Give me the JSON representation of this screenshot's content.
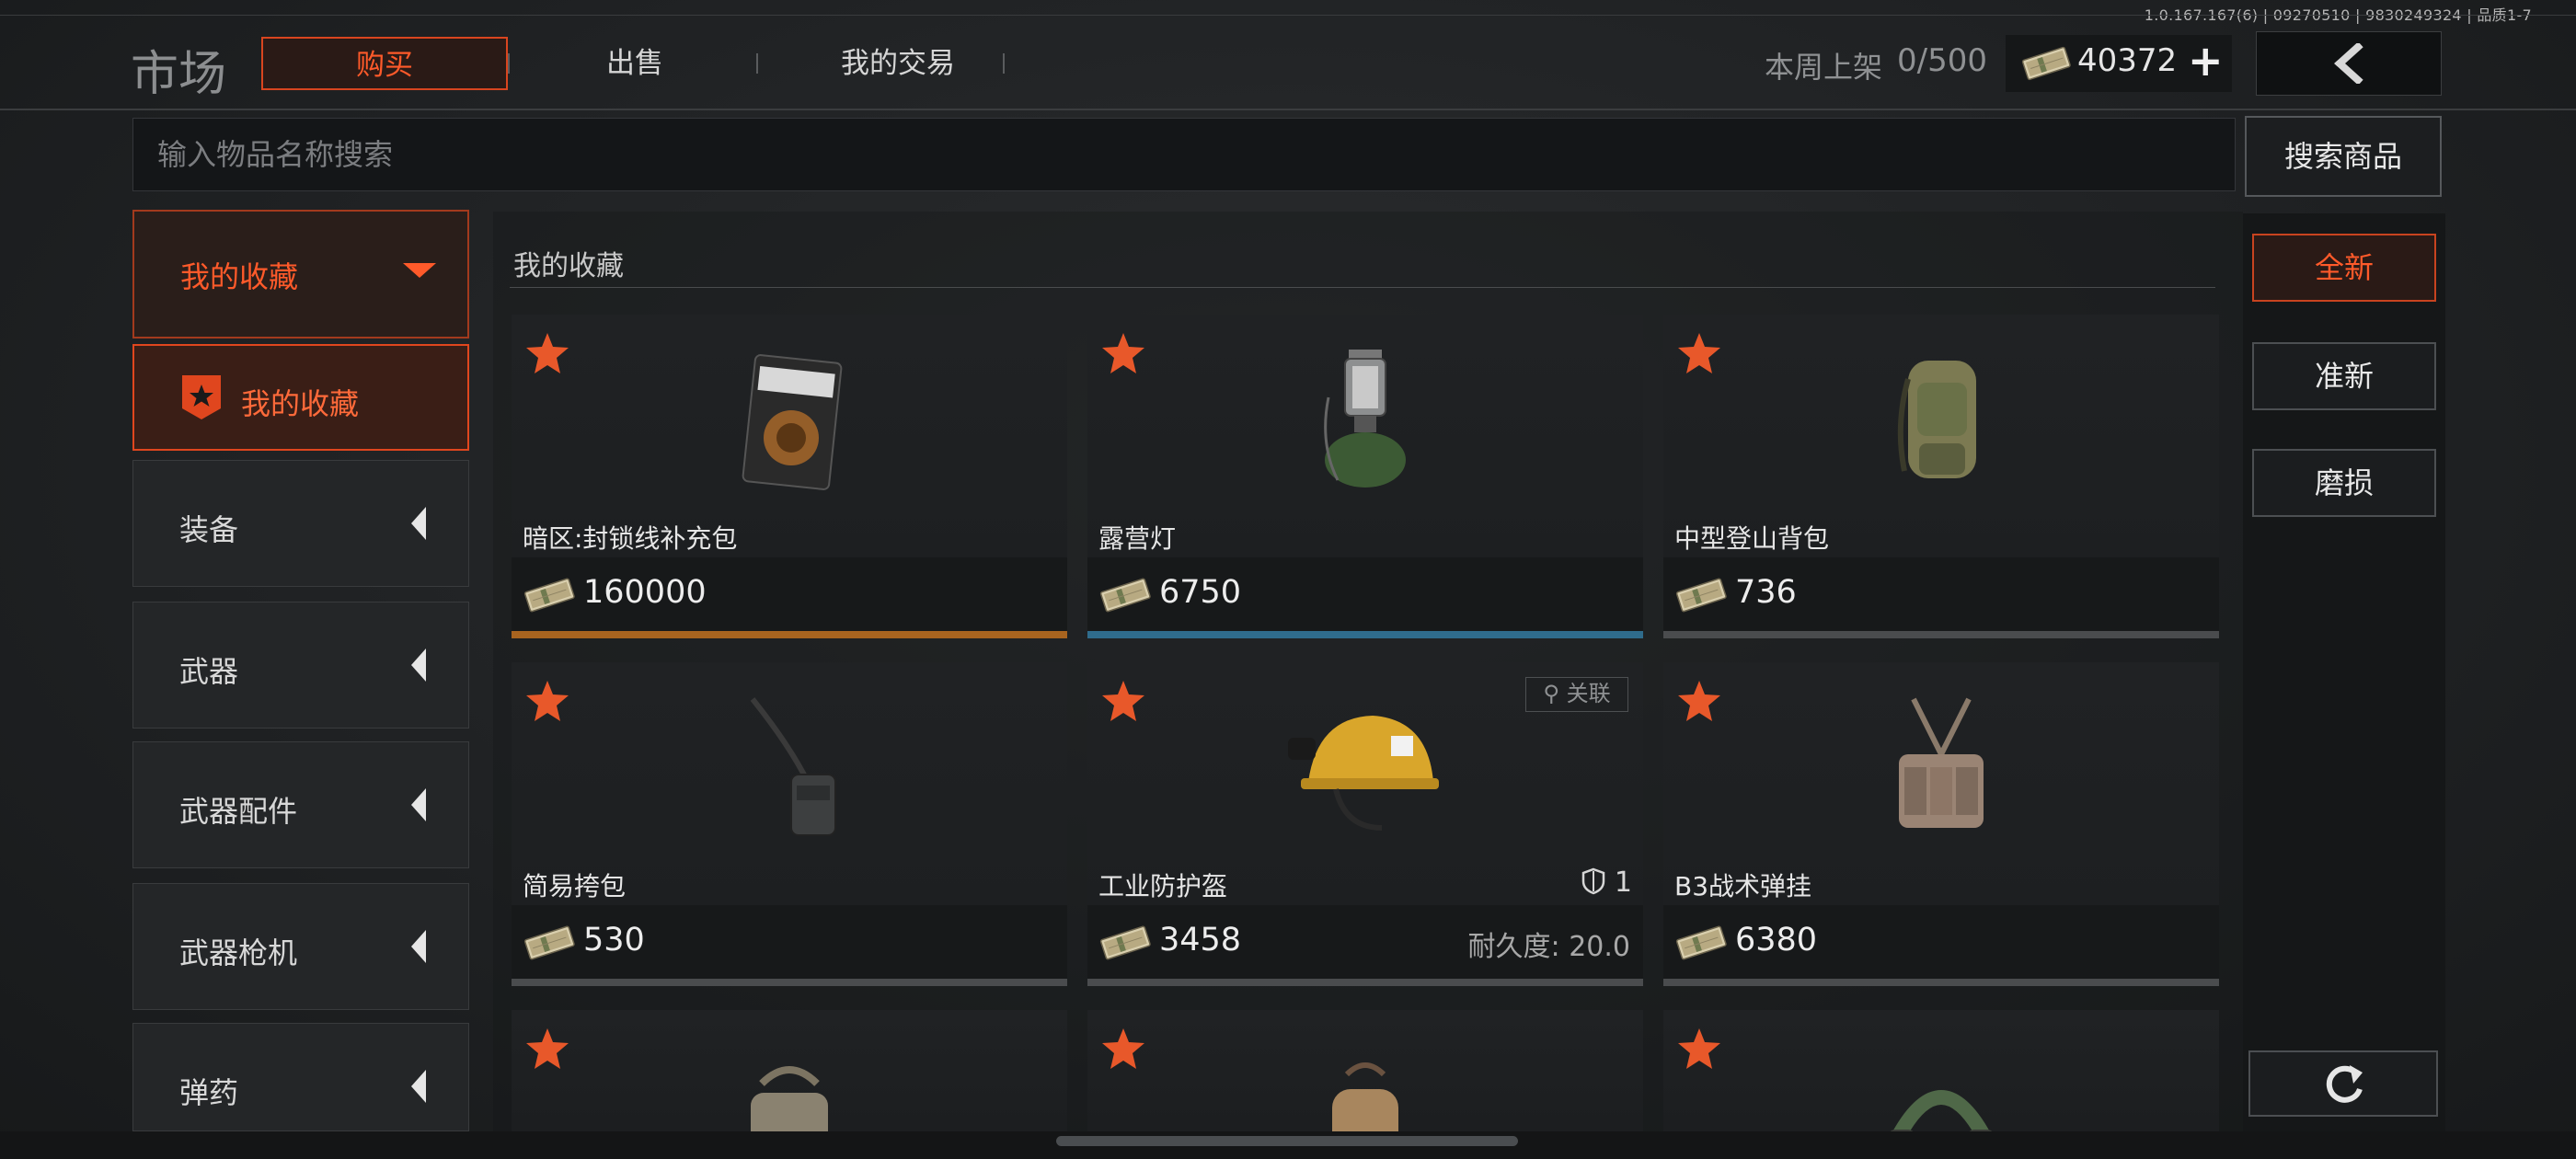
{
  "version": "1.0.167.167(6) | 09270510 | 9830249324 | 品质1-7",
  "header": {
    "title": "市场",
    "tabs": [
      {
        "label": "购买",
        "active": true
      },
      {
        "label": "出售",
        "active": false
      },
      {
        "label": "我的交易",
        "active": false
      }
    ],
    "weekly_label": "本周上架",
    "weekly_value": "0/500",
    "money": "40372"
  },
  "search": {
    "placeholder": "输入物品名称搜索",
    "button": "搜索商品"
  },
  "sidebar": {
    "group": "我的收藏",
    "selected_sub": "我的收藏",
    "items": [
      "装备",
      "武器",
      "武器配件",
      "武器枪机",
      "弹药"
    ]
  },
  "main": {
    "section_title": "我的收藏",
    "cards": [
      {
        "name": "暗区:封锁线补充包",
        "price": "160000",
        "bar_color": "#a8641f"
      },
      {
        "name": "露营灯",
        "price": "6750",
        "bar_color": "#2f6c8c"
      },
      {
        "name": "中型登山背包",
        "price": "736",
        "bar_color": "#4b4d50"
      },
      {
        "name": "简易挎包",
        "price": "530",
        "bar_color": "#4b4d50"
      },
      {
        "name": "工业防护盔",
        "price": "3458",
        "armor_level": "1",
        "durability": "耐久度: 20.0",
        "related_label": "关联",
        "bar_color": "#4b4d50"
      },
      {
        "name": "B3战术弹挂",
        "price": "6380",
        "bar_color": "#4b4d50"
      },
      {
        "name": "",
        "price": "",
        "bar_color": "#4b4d50"
      },
      {
        "name": "",
        "price": "",
        "bar_color": "#4b4d50"
      },
      {
        "name": "",
        "price": "",
        "bar_color": "#4b4d50"
      }
    ]
  },
  "filters": [
    {
      "label": "全新",
      "active": true
    },
    {
      "label": "准新",
      "active": false
    },
    {
      "label": "磨损",
      "active": false
    }
  ],
  "icons": {
    "star": "star-icon",
    "cash": "cash-icon",
    "back": "chevron-left-icon",
    "refresh": "refresh-icon"
  },
  "colors": {
    "accent": "#e0461e",
    "star": "#e8582a"
  }
}
